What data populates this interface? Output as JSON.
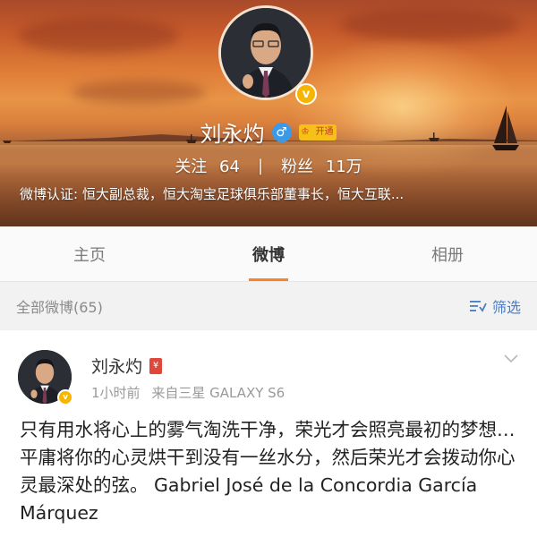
{
  "profile": {
    "name": "刘永灼",
    "verified_badge": "v",
    "gender_icon": "male-icon",
    "vip_badge": {
      "crown": "♔",
      "label": "开通"
    },
    "stats": {
      "following_label": "关注",
      "following_count": "64",
      "separator": "|",
      "followers_label": "粉丝",
      "followers_count": "11万"
    },
    "verification": "微博认证: 恒大副总裁，恒大淘宝足球俱乐部董事长，恒大互联..."
  },
  "tabs": [
    {
      "label": "主页",
      "active": false
    },
    {
      "label": "微博",
      "active": true
    },
    {
      "label": "相册",
      "active": false
    }
  ],
  "filter_bar": {
    "label": "全部微博(65)",
    "filter_button": "筛选"
  },
  "post": {
    "author": "刘永灼",
    "redpack_icon": "¥",
    "verified_badge": "v",
    "time": "1小时前",
    "source": "来自三星 GALAXY S6",
    "body": "只有用水将心上的雾气淘洗干净，荣光才会照亮最初的梦想…平庸将你的心灵烘干到没有一丝水分，然后荣光才会拨动你心灵最深处的弦。 Gabriel José de la Concordia García Márquez"
  },
  "colors": {
    "accent": "#fd8225",
    "link": "#4a7cc4",
    "verified": "#f6b500"
  }
}
